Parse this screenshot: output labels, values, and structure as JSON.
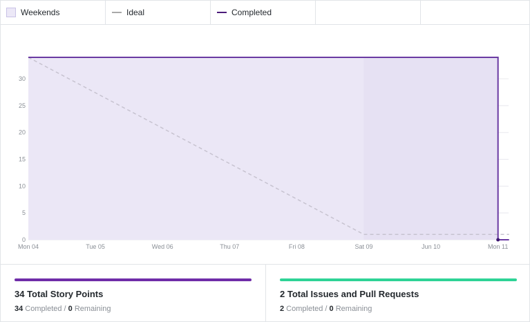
{
  "legend": {
    "weekends_label": "Weekends",
    "ideal_label": "Ideal",
    "completed_label": "Completed"
  },
  "colors": {
    "weekend_fill": "#e6e1f3",
    "area_fill": "#ebe7f6",
    "completed_line": "#6a3aa2",
    "ideal_line": "#c7c3d0",
    "story_bar": "#6f2da8",
    "issues_bar": "#2ed396"
  },
  "chart_data": {
    "type": "line",
    "x_tick_labels": [
      "Mon 04",
      "Tue 05",
      "Wed 06",
      "Thu 07",
      "Fri 08",
      "Sat 09",
      "Jun 10",
      "Mon 11"
    ],
    "y_tick_labels": [
      "0",
      "5",
      "10",
      "15",
      "20",
      "25",
      "30"
    ],
    "ylim": [
      0,
      34
    ],
    "weekend_span": [
      "Sat 09",
      "Mon 11"
    ],
    "series": [
      {
        "name": "Ideal",
        "style": "dashed",
        "points": [
          {
            "x": "Mon 04",
            "y": 34
          },
          {
            "x": "Sat 09",
            "y": 1
          },
          {
            "x": "Mon 11",
            "y": 1
          }
        ]
      },
      {
        "name": "Completed",
        "style": "solid",
        "points": [
          {
            "x": "Mon 04",
            "y": 34
          },
          {
            "x": "Mon 11",
            "y": 34
          },
          {
            "x": "Mon 11",
            "y": 0
          }
        ]
      }
    ]
  },
  "stats": {
    "story": {
      "title": "34 Total Story Points",
      "completed_value": "34",
      "completed_label": " Completed / ",
      "remaining_value": "0",
      "remaining_label": " Remaining"
    },
    "issues": {
      "title": "2 Total Issues and Pull Requests",
      "completed_value": "2",
      "completed_label": " Completed / ",
      "remaining_value": "0",
      "remaining_label": " Remaining"
    }
  }
}
